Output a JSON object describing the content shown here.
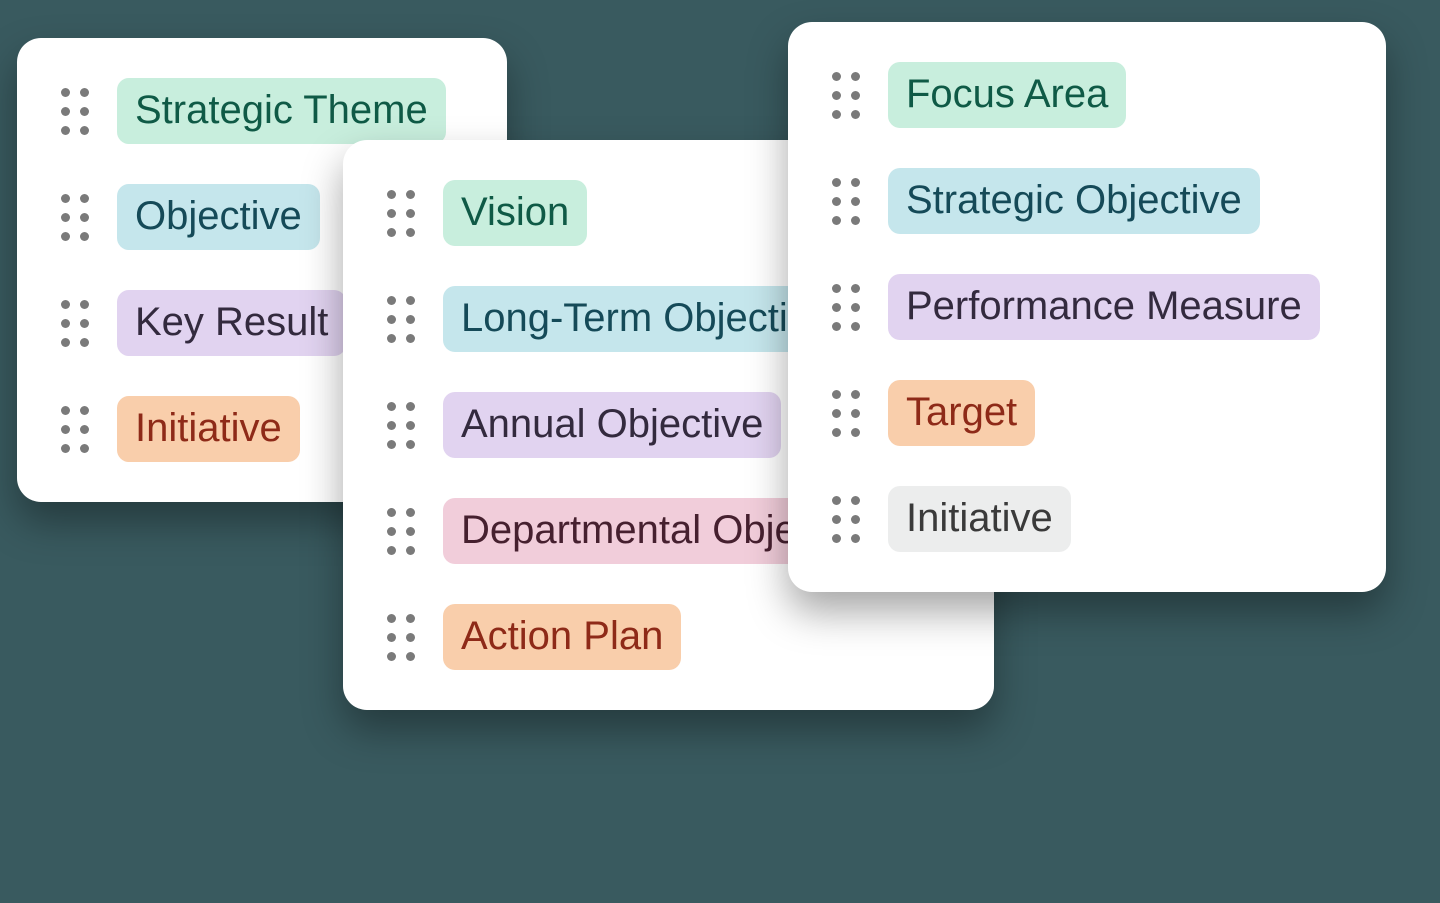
{
  "cards": {
    "left": {
      "items": [
        {
          "label": "Strategic Theme",
          "color": "green"
        },
        {
          "label": "Objective",
          "color": "blue"
        },
        {
          "label": "Key Result",
          "color": "purple"
        },
        {
          "label": "Initiative",
          "color": "orange"
        }
      ]
    },
    "middle": {
      "items": [
        {
          "label": "Vision",
          "color": "green"
        },
        {
          "label": "Long-Term Objective",
          "color": "blue"
        },
        {
          "label": "Annual Objective",
          "color": "purple"
        },
        {
          "label": "Departmental Objective",
          "color": "pink"
        },
        {
          "label": "Action Plan",
          "color": "orange"
        }
      ]
    },
    "right": {
      "items": [
        {
          "label": "Focus Area",
          "color": "green"
        },
        {
          "label": "Strategic Objective",
          "color": "blue"
        },
        {
          "label": "Performance Measure",
          "color": "purple"
        },
        {
          "label": "Target",
          "color": "orange"
        },
        {
          "label": "Initiative",
          "color": "gray"
        }
      ]
    }
  }
}
